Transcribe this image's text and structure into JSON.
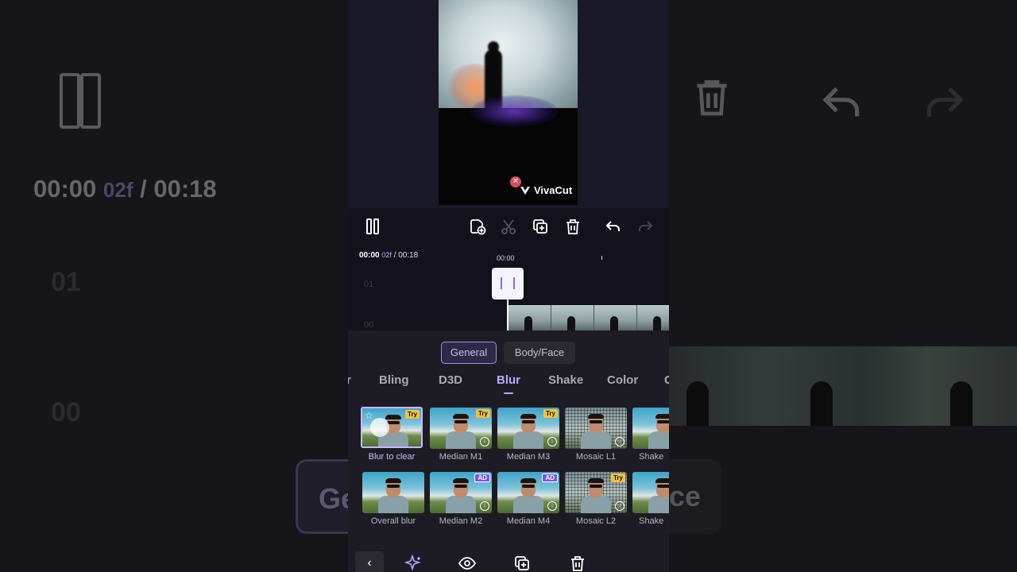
{
  "background": {
    "time_main": "00:00",
    "time_frame": "02f",
    "time_total": "/ 00:18",
    "lane_top": "01",
    "lane_bottom": "00",
    "general_ghost": "Ge",
    "face_ghost": "ce"
  },
  "preview": {
    "watermark": "VivaCut",
    "watermark_close": "✕"
  },
  "toolbar": {
    "play_pause": "pause-icon",
    "icons": [
      "add-overlay-icon",
      "split-icon",
      "duplicate-icon",
      "delete-icon",
      "undo-icon",
      "redo-icon"
    ]
  },
  "timeline": {
    "current": "00:00",
    "current_frame": "02f",
    "total": "/ 00:18",
    "ruler_label": "00:00",
    "lanes": [
      "01",
      "00"
    ]
  },
  "panel": {
    "segments": [
      "General",
      "Body/Face"
    ],
    "categories": [
      "r",
      "Bling",
      "D3D",
      "Blur",
      "Shake",
      "Color",
      "G"
    ],
    "active_category": "Blur",
    "effects_row1": [
      {
        "label": "Blur to clear",
        "badge": "Try",
        "selected": true
      },
      {
        "label": "Median M1",
        "badge": "Try"
      },
      {
        "label": "Median M3",
        "badge": "Try"
      },
      {
        "label": "Mosaic L1",
        "badge": ""
      },
      {
        "label": "Shake",
        "badge": ""
      }
    ],
    "effects_row2": [
      {
        "label": "Overall blur",
        "badge": ""
      },
      {
        "label": "Median M2",
        "badge": "AD"
      },
      {
        "label": "Median M4",
        "badge": "AD"
      },
      {
        "label": "Mosaic L2",
        "badge": "Try"
      },
      {
        "label": "Shake",
        "badge": ""
      }
    ]
  },
  "bottombar": {
    "back": "‹",
    "icons": [
      "sparkle-icon",
      "eye-icon",
      "duplicate-icon",
      "delete-icon"
    ]
  },
  "colors": {
    "accent": "#b9a8ff",
    "panel_bg": "#1d1c24",
    "badge_try": "#f3c23a",
    "badge_ad": "#7a55e8"
  }
}
